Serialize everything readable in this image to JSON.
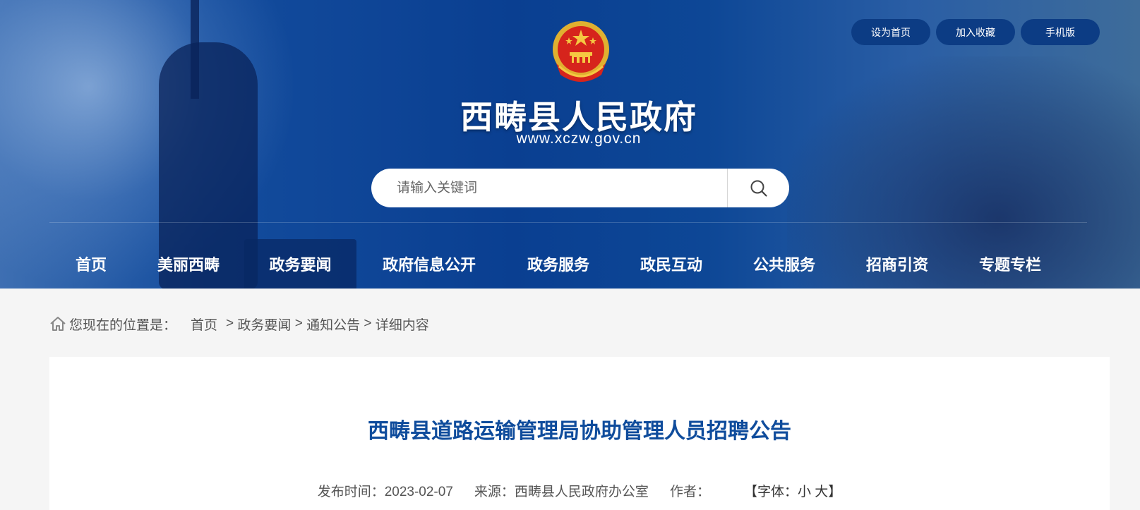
{
  "top_links": [
    "设为首页",
    "加入收藏",
    "手机版"
  ],
  "site": {
    "title": "西畴县人民政府",
    "url": "www.xczw.gov.cn"
  },
  "search": {
    "placeholder": "请输入关键词"
  },
  "nav": [
    "首页",
    "美丽西畴",
    "政务要闻",
    "政府信息公开",
    "政务服务",
    "政民互动",
    "公共服务",
    "招商引资",
    "专题专栏"
  ],
  "nav_active": "政务要闻",
  "breadcrumb": {
    "prefix": "您现在的位置是：",
    "items": [
      "首页",
      "政务要闻",
      "通知公告",
      "详细内容"
    ],
    "separator": ">"
  },
  "article": {
    "title": "西畴县道路运输管理局协助管理人员招聘公告",
    "publish_label": "发布时间：",
    "publish_date": "2023-02-07",
    "source_label": "来源：",
    "source": "西畴县人民政府办公室",
    "author_label": "作者：",
    "author": "",
    "font_size_open": "【字体：",
    "font_small": "小",
    "font_large": "大",
    "font_size_close": "】"
  },
  "colors": {
    "header_blue": "#0a3f91",
    "title_blue": "#0f4c9c",
    "background": "#f5f5f5"
  }
}
